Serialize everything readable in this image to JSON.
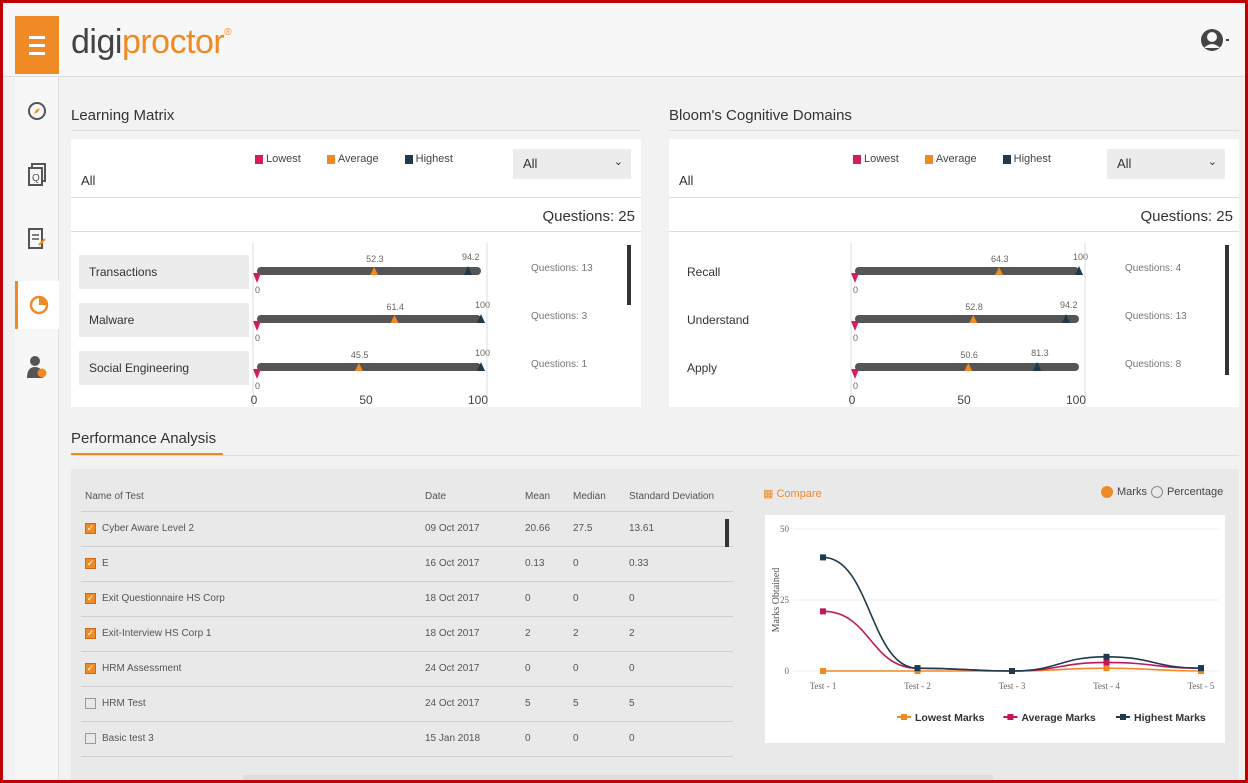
{
  "app": {
    "logo_part1": "digi",
    "logo_part2": "proctor",
    "logo_mark": "®"
  },
  "icons": {
    "menu": "hamburger-icon",
    "user": "user-account-icon",
    "sidebar": [
      "compass-icon",
      "question-paper-icon",
      "checklist-icon",
      "pie-chart-icon",
      "user-settings-icon"
    ]
  },
  "colors": {
    "lowest": "#d81b5a",
    "average": "#f08a24",
    "highest": "#1e3a4c",
    "accent": "#f08a24",
    "bar": "#555555"
  },
  "legend": {
    "lowest": "Lowest",
    "average": "Average",
    "highest": "Highest"
  },
  "learning_matrix": {
    "title": "Learning Matrix",
    "filter_label": "All",
    "dropdown_value": "All",
    "questions_total": "Questions: 25",
    "rows": [
      {
        "label": "Transactions",
        "low": 0,
        "avg": 52.3,
        "high": 94.2,
        "low_text": "0",
        "avg_text": "52.3",
        "high_text": "94.2",
        "questions": "Questions: 13"
      },
      {
        "label": "Malware",
        "low": 0,
        "avg": 61.4,
        "high": 100,
        "low_text": "0",
        "avg_text": "61.4",
        "high_text": "100",
        "questions": "Questions: 3"
      },
      {
        "label": "Social Engineering",
        "low": 0,
        "avg": 45.5,
        "high": 100,
        "low_text": "0",
        "avg_text": "45.5",
        "high_text": "100",
        "questions": "Questions: 1"
      }
    ],
    "axis_ticks": [
      "0",
      "50",
      "100"
    ]
  },
  "bloom": {
    "title": "Bloom's Cognitive Domains",
    "filter_label": "All",
    "dropdown_value": "All",
    "questions_total": "Questions: 25",
    "rows": [
      {
        "label": "Recall",
        "low": 0,
        "avg": 64.3,
        "high": 100,
        "low_text": "0",
        "avg_text": "64.3",
        "high_text": "100",
        "questions": "Questions: 4"
      },
      {
        "label": "Understand",
        "low": 0,
        "avg": 52.8,
        "high": 94.2,
        "low_text": "0",
        "avg_text": "52.8",
        "high_text": "94.2",
        "questions": "Questions: 13"
      },
      {
        "label": "Apply",
        "low": 0,
        "avg": 50.6,
        "high": 81.3,
        "low_text": "0",
        "avg_text": "50.6",
        "high_text": "81.3",
        "questions": "Questions: 8"
      }
    ],
    "axis_ticks": [
      "0",
      "50",
      "100"
    ]
  },
  "performance": {
    "title": "Performance Analysis",
    "columns": [
      "Name of Test",
      "Date",
      "Mean",
      "Median",
      "Standard Deviation"
    ],
    "rows": [
      {
        "checked": true,
        "name": "Cyber Aware Level 2",
        "date": "09 Oct 2017",
        "mean": "20.66",
        "median": "27.5",
        "sd": "13.61"
      },
      {
        "checked": true,
        "name": "E",
        "date": "16 Oct 2017",
        "mean": "0.13",
        "median": "0",
        "sd": "0.33"
      },
      {
        "checked": true,
        "name": "Exit Questionnaire HS Corp",
        "date": "18 Oct 2017",
        "mean": "0",
        "median": "0",
        "sd": "0"
      },
      {
        "checked": true,
        "name": "Exit-Interview HS Corp 1",
        "date": "18 Oct 2017",
        "mean": "2",
        "median": "2",
        "sd": "2"
      },
      {
        "checked": true,
        "name": "HRM Assessment",
        "date": "24 Oct 2017",
        "mean": "0",
        "median": "0",
        "sd": "0"
      },
      {
        "checked": false,
        "name": "HRM Test",
        "date": "24 Oct 2017",
        "mean": "5",
        "median": "5",
        "sd": "5"
      },
      {
        "checked": false,
        "name": "Basic test 3",
        "date": "15 Jan 2018",
        "mean": "0",
        "median": "0",
        "sd": "0"
      }
    ],
    "compare_label": "Compare",
    "radio_marks": "Marks",
    "radio_percentage": "Percentage"
  },
  "chart_data": {
    "type": "line",
    "categories": [
      "Test - 1",
      "Test - 2",
      "Test - 3",
      "Test - 4",
      "Test - 5"
    ],
    "ylabel": "Marks Obtained",
    "ylim": [
      0,
      50
    ],
    "yticks": [
      "0",
      "25",
      "50"
    ],
    "legend_position": "bottom-right",
    "series": [
      {
        "name": "Lowest Marks",
        "color": "#f08a24",
        "values": [
          0,
          0,
          0,
          1,
          0
        ]
      },
      {
        "name": "Average Marks",
        "color": "#c2185b",
        "values": [
          21,
          1,
          0,
          3,
          1
        ]
      },
      {
        "name": "Highest Marks",
        "color": "#1e3a4c",
        "values": [
          40,
          1,
          0,
          5,
          1
        ]
      }
    ]
  }
}
